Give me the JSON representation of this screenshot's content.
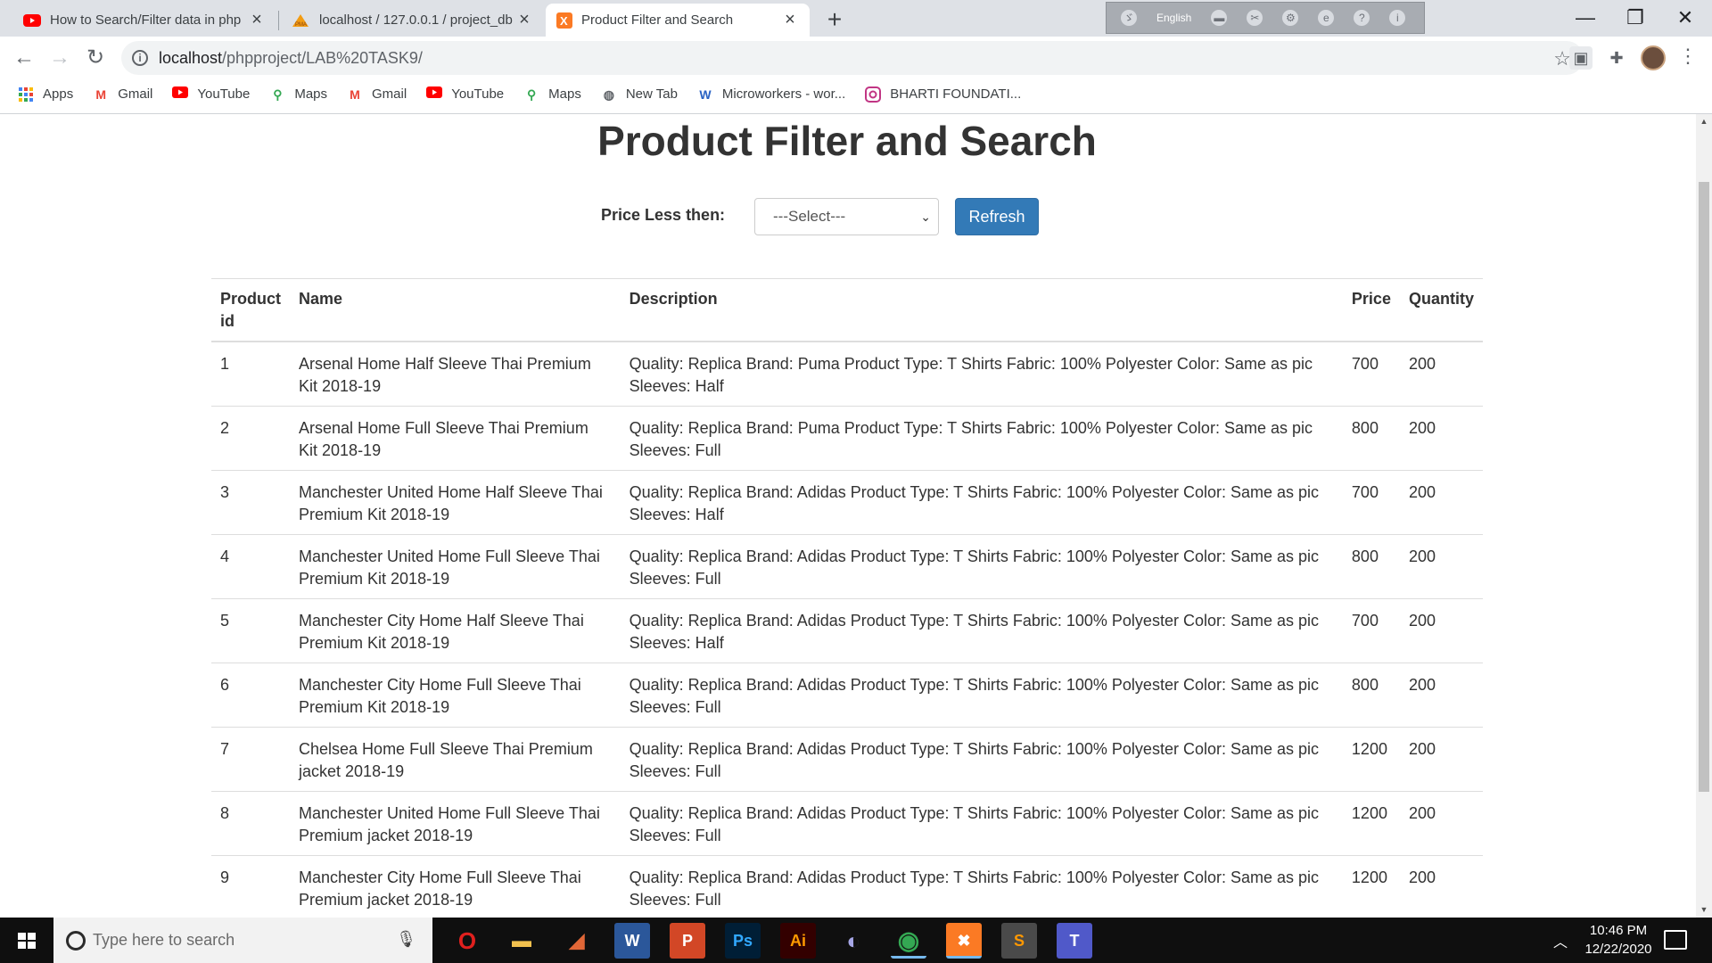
{
  "browser": {
    "tabs": [
      {
        "title": "How to Search/Filter data in php",
        "icon": "youtube-icon",
        "active": false
      },
      {
        "title": "localhost / 127.0.0.1 / project_db",
        "icon": "phpmyadmin-icon",
        "active": false
      },
      {
        "title": "Product Filter and Search",
        "icon": "xampp-icon",
        "active": true
      }
    ],
    "new_tab": "+",
    "language_bar": {
      "label": "English"
    },
    "window_controls": {
      "minimize": "—",
      "restore": "❐",
      "close": "✕"
    },
    "url_host": "localhost",
    "url_path": "/phpproject/LAB%20TASK9/",
    "bookmarks": [
      {
        "label": "Apps",
        "icon": "apps-grid-icon"
      },
      {
        "label": "Gmail",
        "icon": "gmail-icon"
      },
      {
        "label": "YouTube",
        "icon": "youtube-icon"
      },
      {
        "label": "Maps",
        "icon": "maps-pin-icon"
      },
      {
        "label": "Gmail",
        "icon": "gmail-icon"
      },
      {
        "label": "YouTube",
        "icon": "youtube-icon"
      },
      {
        "label": "Maps",
        "icon": "maps-pin-icon"
      },
      {
        "label": "New Tab",
        "icon": "globe-icon"
      },
      {
        "label": "Microworkers - wor...",
        "icon": "microworkers-icon"
      },
      {
        "label": "BHARTI FOUNDATI...",
        "icon": "instagram-icon"
      }
    ]
  },
  "page": {
    "title": "Product Filter and Search",
    "filter_label": "Price Less then:",
    "select_value": "---Select---",
    "refresh_label": "Refresh",
    "table": {
      "headers": {
        "id": "Product id",
        "name": "Name",
        "description": "Description",
        "price": "Price",
        "quantity": "Quantity"
      },
      "rows": [
        {
          "id": "1",
          "name": "Arsenal Home Half Sleeve Thai Premium Kit 2018-19",
          "description": "Quality: Replica Brand: Puma Product Type: T Shirts Fabric: 100% Polyester Color: Same as pic Sleeves: Half",
          "price": "700",
          "quantity": "200"
        },
        {
          "id": "2",
          "name": "Arsenal Home Full Sleeve Thai Premium Kit 2018-19",
          "description": "Quality: Replica Brand: Puma Product Type: T Shirts Fabric: 100% Polyester Color: Same as pic Sleeves: Full",
          "price": "800",
          "quantity": "200"
        },
        {
          "id": "3",
          "name": "Manchester United Home Half Sleeve Thai Premium Kit 2018-19",
          "description": "Quality: Replica Brand: Adidas Product Type: T Shirts Fabric: 100% Polyester Color: Same as pic Sleeves: Half",
          "price": "700",
          "quantity": "200"
        },
        {
          "id": "4",
          "name": "Manchester United Home Full Sleeve Thai Premium Kit 2018-19",
          "description": "Quality: Replica Brand: Adidas Product Type: T Shirts Fabric: 100% Polyester Color: Same as pic Sleeves: Full",
          "price": "800",
          "quantity": "200"
        },
        {
          "id": "5",
          "name": "Manchester City Home Half Sleeve Thai Premium Kit 2018-19",
          "description": "Quality: Replica Brand: Adidas Product Type: T Shirts Fabric: 100% Polyester Color: Same as pic Sleeves: Half",
          "price": "700",
          "quantity": "200"
        },
        {
          "id": "6",
          "name": "Manchester City Home Full Sleeve Thai Premium Kit 2018-19",
          "description": "Quality: Replica Brand: Adidas Product Type: T Shirts Fabric: 100% Polyester Color: Same as pic Sleeves: Full",
          "price": "800",
          "quantity": "200"
        },
        {
          "id": "7",
          "name": "Chelsea Home Full Sleeve Thai Premium jacket 2018-19",
          "description": "Quality: Replica Brand: Adidas Product Type: T Shirts Fabric: 100% Polyester Color: Same as pic Sleeves: Full",
          "price": "1200",
          "quantity": "200"
        },
        {
          "id": "8",
          "name": "Manchester United Home Full Sleeve Thai Premium jacket 2018-19",
          "description": "Quality: Replica Brand: Adidas Product Type: T Shirts Fabric: 100% Polyester Color: Same as pic Sleeves: Full",
          "price": "1200",
          "quantity": "200"
        },
        {
          "id": "9",
          "name": "Manchester City Home Full Sleeve Thai Premium jacket 2018-19",
          "description": "Quality: Replica Brand: Adidas Product Type: T Shirts Fabric: 100% Polyester Color: Same as pic Sleeves: Full",
          "price": "1200",
          "quantity": "200"
        }
      ]
    }
  },
  "taskbar": {
    "search_placeholder": "Type here to search",
    "apps": [
      {
        "name": "opera-icon",
        "glyph": "O",
        "color": "#e0201e"
      },
      {
        "name": "file-explorer-icon",
        "glyph": "▬",
        "color": "#f2c14e"
      },
      {
        "name": "matlab-icon",
        "glyph": "◢",
        "color": "#e16737"
      },
      {
        "name": "word-icon",
        "glyph": "W",
        "color": "#2b579a"
      },
      {
        "name": "powerpoint-icon",
        "glyph": "P",
        "color": "#d24726"
      },
      {
        "name": "photoshop-icon",
        "glyph": "Ps",
        "color": "#001e36"
      },
      {
        "name": "illustrator-icon",
        "glyph": "Ai",
        "color": "#330000"
      },
      {
        "name": "eclipse-icon",
        "glyph": "◐",
        "color": "#3b3b6d"
      },
      {
        "name": "chrome-icon",
        "glyph": "◉",
        "color": "#34a853"
      },
      {
        "name": "xampp-icon",
        "glyph": "✖",
        "color": "#fb7a24"
      },
      {
        "name": "sublime-icon",
        "glyph": "S",
        "color": "#ff9800"
      },
      {
        "name": "teams-icon",
        "glyph": "T",
        "color": "#5059c9"
      }
    ],
    "time": "10:46 PM",
    "date": "12/22/2020"
  },
  "colors": {
    "primary_button": "#337ab7",
    "tabstrip": "#dee1e6",
    "taskbar": "#0f0f0f"
  }
}
